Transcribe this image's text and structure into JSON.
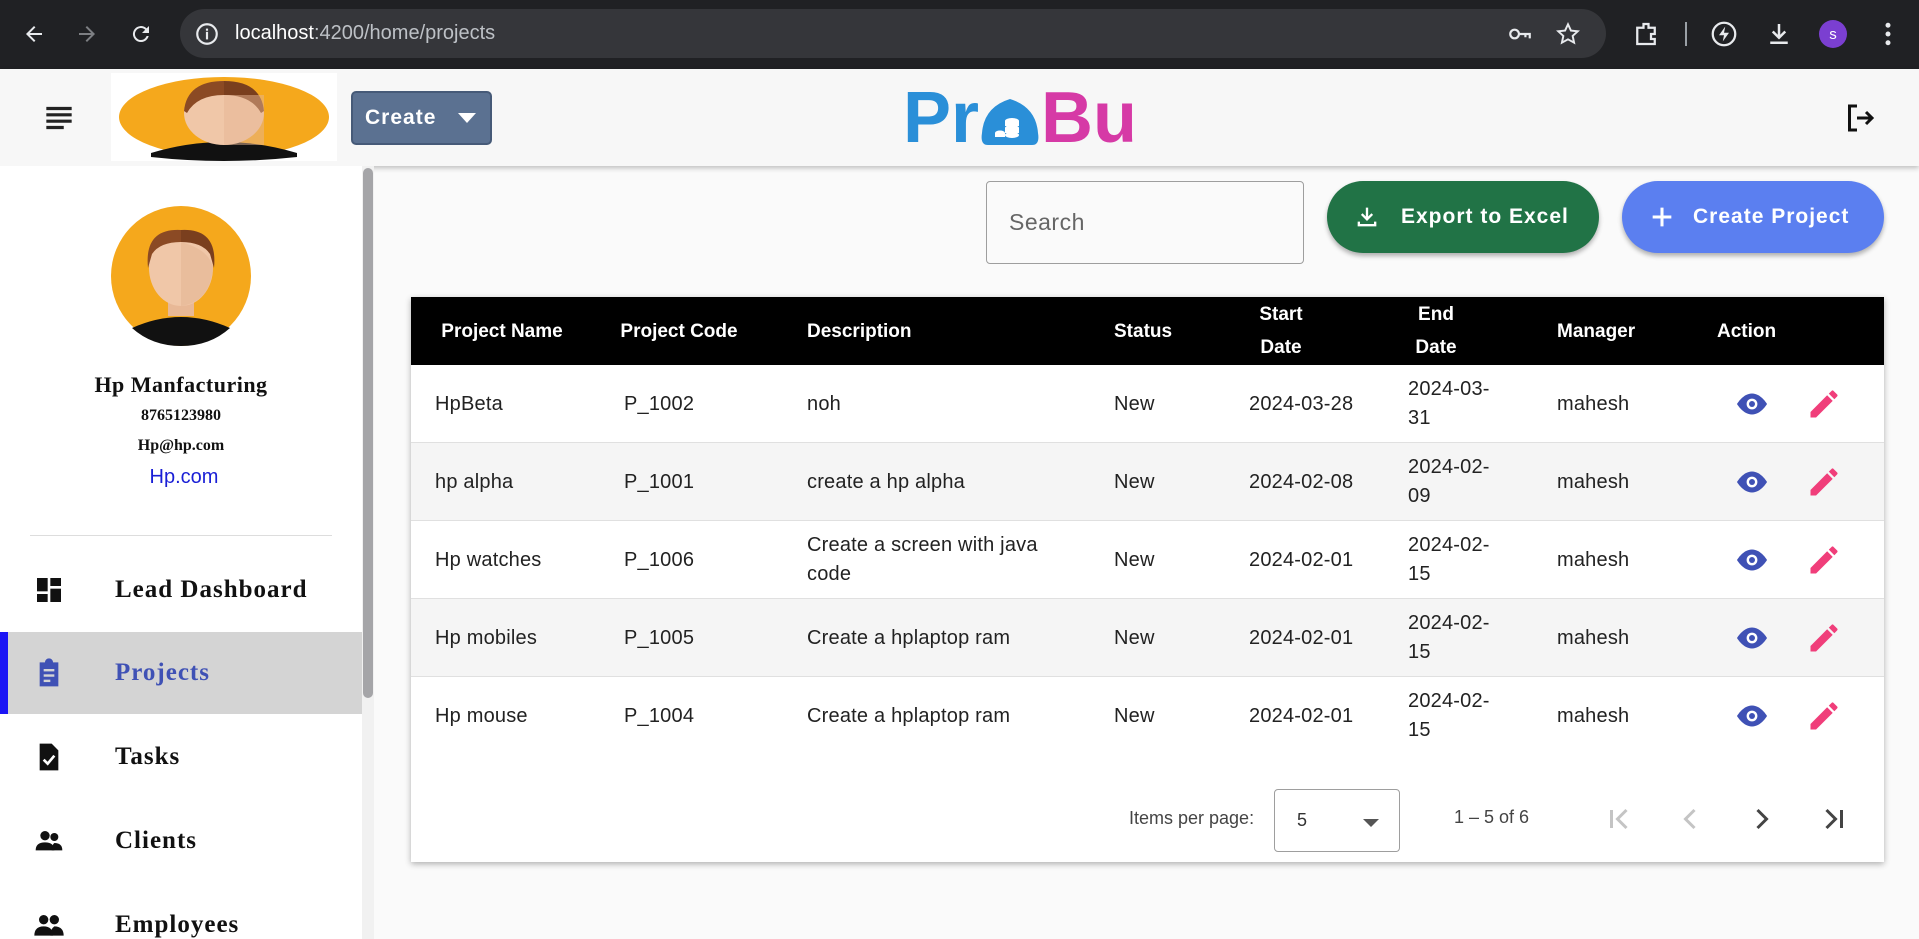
{
  "browser": {
    "url_host": "localhost",
    "url_path": ":4200/home/projects",
    "profile_initial": "s"
  },
  "header": {
    "create_label": "Create",
    "brand_left": "Pr",
    "brand_right": "Bu"
  },
  "sidebar": {
    "company_name": "Hp Manfacturing",
    "phone": "8765123980",
    "email": "Hp@hp.com",
    "website": "Hp.com",
    "items": [
      {
        "label": "Lead Dashboard",
        "icon": "dashboard-icon"
      },
      {
        "label": "Projects",
        "icon": "assignment-icon",
        "active": true
      },
      {
        "label": "Tasks",
        "icon": "task-icon"
      },
      {
        "label": "Clients",
        "icon": "clients-icon"
      },
      {
        "label": "Employees",
        "icon": "employees-icon"
      }
    ]
  },
  "toolbar": {
    "search_placeholder": "Search",
    "export_label": "Export to Excel",
    "create_project_label": "Create Project"
  },
  "table": {
    "columns": [
      "Project Name",
      "Project Code",
      "Description",
      "Status",
      "Start Date",
      "End Date",
      "Manager",
      "Action"
    ],
    "rows": [
      {
        "name": "HpBeta",
        "code": "P_1002",
        "description": "noh",
        "status": "New",
        "start": "2024-03-28",
        "end": "2024-03-31",
        "manager": "mahesh"
      },
      {
        "name": "hp alpha",
        "code": "P_1001",
        "description": "create a hp alpha",
        "status": "New",
        "start": "2024-02-08",
        "end": "2024-02-09",
        "manager": "mahesh"
      },
      {
        "name": "Hp watches",
        "code": "P_1006",
        "description": "Create a screen with java code",
        "status": "New",
        "start": "2024-02-01",
        "end": "2024-02-15",
        "manager": "mahesh"
      },
      {
        "name": "Hp mobiles",
        "code": "P_1005",
        "description": "Create a hplaptop ram",
        "status": "New",
        "start": "2024-02-01",
        "end": "2024-02-15",
        "manager": "mahesh"
      },
      {
        "name": "Hp mouse",
        "code": "P_1004",
        "description": "Create a hplaptop ram",
        "status": "New",
        "start": "2024-02-01",
        "end": "2024-02-15",
        "manager": "mahesh"
      }
    ]
  },
  "paginator": {
    "items_per_page_label": "Items per page:",
    "page_size": "5",
    "range": "1 – 5 of 6"
  },
  "colors": {
    "export_green": "#217346",
    "create_blue": "#5b7ff0",
    "view_icon": "#3f51b5",
    "edit_icon": "#f03e7a",
    "active_bar": "#1c15f5"
  }
}
